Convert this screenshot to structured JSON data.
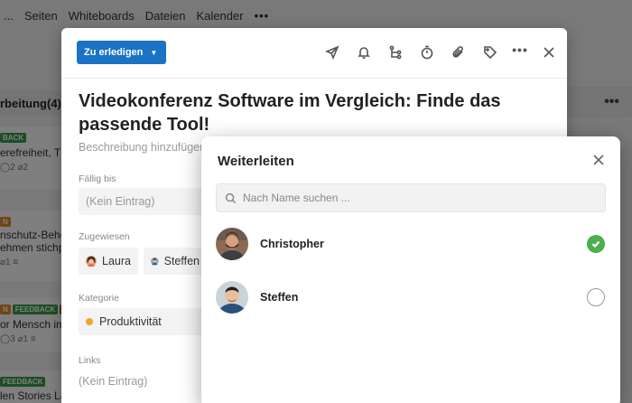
{
  "background": {
    "nav": [
      "Seiten",
      "Whiteboards",
      "Dateien",
      "Kalender"
    ],
    "nav_cut": "...",
    "nav_more": "•••",
    "column_title": "rbeitung(4)",
    "column_more": "•••",
    "cards": [
      {
        "tags": [
          {
            "text": "BACK",
            "color": "green"
          }
        ],
        "text": "erefreiheit, T",
        "meta": "◯2 ⌀2"
      },
      {
        "tags": [
          {
            "text": "N",
            "color": "orange"
          }
        ],
        "text": "nschutz-Behö",
        "text2": "ehmen stichp",
        "meta": "⌀1 ≡"
      },
      {
        "tags": [
          {
            "text": "N",
            "color": "orange"
          },
          {
            "text": "FEEDBACK",
            "color": "green"
          },
          {
            "text": "AS",
            "color": "red"
          }
        ],
        "text": "or Mensch im",
        "meta": "◯3 ⌀1 ≡"
      },
      {
        "tags": [
          {
            "text": "FEEDBACK",
            "color": "green"
          }
        ],
        "text": "len Stories La",
        "meta": ""
      }
    ]
  },
  "task": {
    "status_label": "Zu erledigen",
    "title": "Videokonferenz Software im Vergleich: Finde das passende Tool!",
    "description_placeholder": "Beschreibung hinzufügen",
    "due_label": "Fällig bis",
    "due_value": "(Kein Eintrag)",
    "assigned_label": "Zugewiesen",
    "assignees": [
      "Laura",
      "Steffen"
    ],
    "category_label": "Kategorie",
    "category_value": "Produktivität",
    "links_label": "Links",
    "links_value": "(Kein Eintrag)",
    "colors": {
      "status": "#1a73c4",
      "category_dot": "#f0a52b"
    }
  },
  "forward": {
    "title": "Weiterleiten",
    "search_placeholder": "Nach Name suchen ...",
    "search_value": "",
    "people": [
      {
        "name": "Christopher",
        "selected": true
      },
      {
        "name": "Steffen",
        "selected": false
      }
    ],
    "colors": {
      "selected": "#4caf50"
    }
  }
}
